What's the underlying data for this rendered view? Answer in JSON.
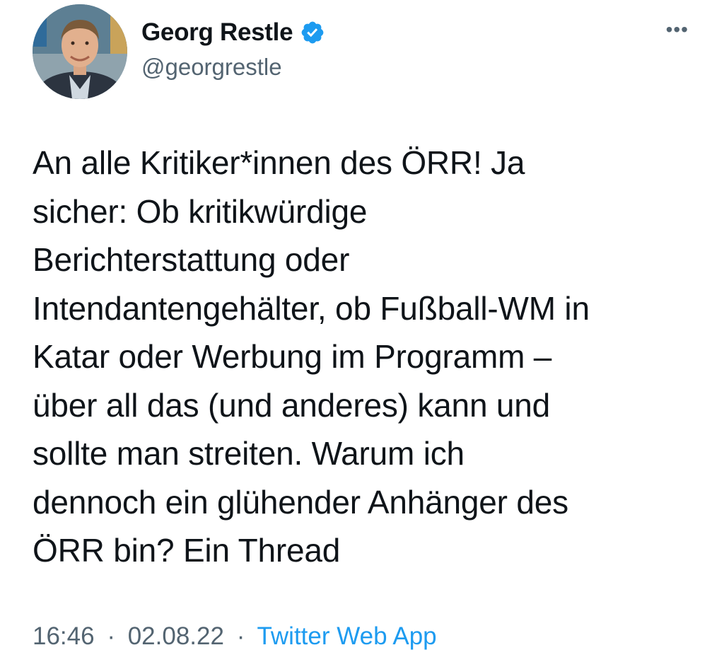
{
  "tweet": {
    "author": {
      "display_name": "Georg Restle",
      "handle": "@georgrestle",
      "verified": true,
      "verified_icon": "verified-badge-icon",
      "verified_color": "#1d9bf0"
    },
    "more_menu_icon": "more-horizontal-icon",
    "text": "An alle Kritiker*innen des ÖRR! Ja\nsicher: Ob kritikwürdige\nBerichterstattung oder\nIntendantengehälter, ob Fußball-WM in\nKatar oder Werbung im Programm –\nüber all das (und anderes) kann und\nsollte man streiten. Warum ich\ndennoch ein glühender Anhänger des\nÖRR bin? Ein Thread",
    "time": "16:46",
    "date": "02.08.22",
    "separator": "·",
    "source": "Twitter Web App",
    "colors": {
      "text": "#0f1419",
      "secondary": "#536471",
      "accent": "#1d9bf0"
    }
  }
}
